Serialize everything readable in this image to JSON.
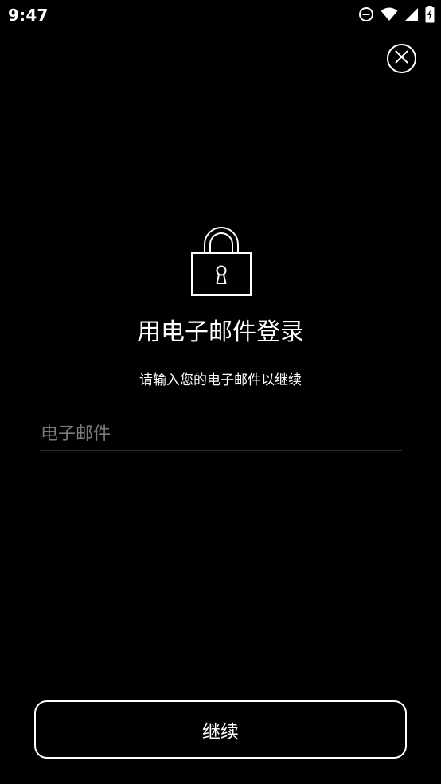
{
  "status_bar": {
    "time": "9:47",
    "icons": [
      "do-not-disturb-icon",
      "wifi-icon",
      "cellular-signal-icon",
      "battery-charging-icon"
    ]
  },
  "close_button": {
    "icon": "close-icon"
  },
  "lock": {
    "icon": "padlock-icon"
  },
  "login": {
    "title": "用电子邮件登录",
    "subtitle": "请输入您的电子邮件以继续",
    "email_placeholder": "电子邮件",
    "email_value": "",
    "continue_label": "继续"
  },
  "colors": {
    "background": "#000000",
    "foreground": "#ffffff",
    "placeholder": "#7a7a7a",
    "underline": "#2a2a2a"
  }
}
